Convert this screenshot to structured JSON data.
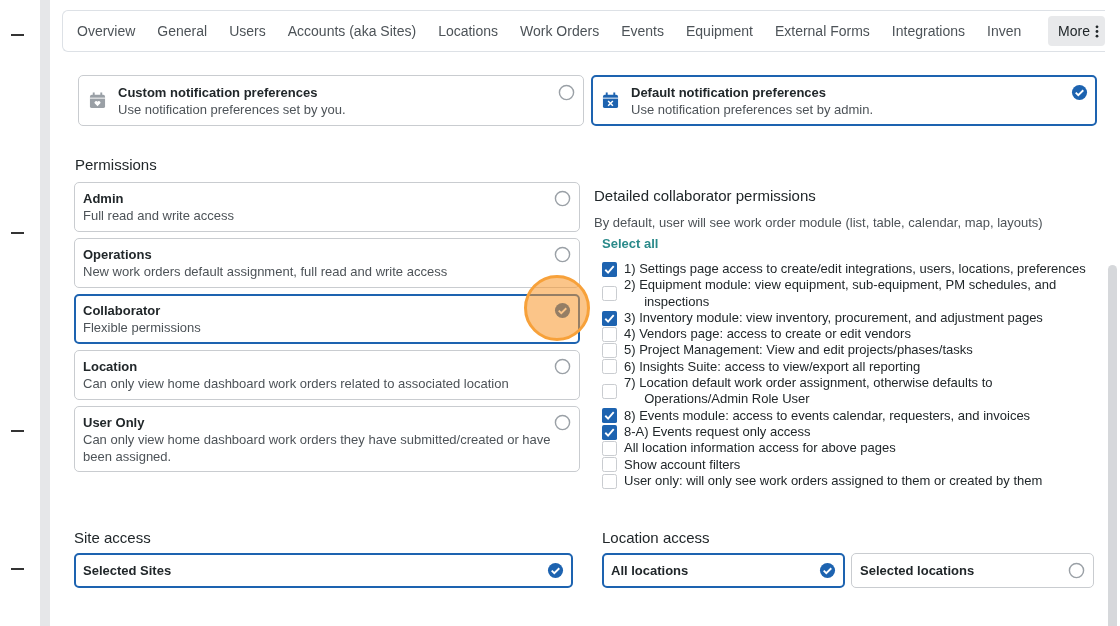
{
  "tabs": [
    {
      "label": "Overview",
      "selected": false
    },
    {
      "label": "General",
      "selected": false
    },
    {
      "label": "Users",
      "selected": false
    },
    {
      "label": "Accounts (aka Sites)",
      "selected": false
    },
    {
      "label": "Locations",
      "selected": false
    },
    {
      "label": "Work Orders",
      "selected": false
    },
    {
      "label": "Events",
      "selected": false
    },
    {
      "label": "Equipment",
      "selected": false
    },
    {
      "label": "External Forms",
      "selected": false
    },
    {
      "label": "Integrations",
      "selected": false
    },
    {
      "label": "Inven",
      "selected": false
    }
  ],
  "more_button": {
    "label": "More"
  },
  "notification_preferences": [
    {
      "kind": "custom",
      "title": "Custom notification preferences",
      "description": "Use notification preferences set by you.",
      "selected": false
    },
    {
      "kind": "default",
      "title": "Default notification preferences",
      "description": "Use notification preferences set by admin.",
      "selected": true
    }
  ],
  "permissions": {
    "heading": "Permissions",
    "roles": [
      {
        "title": "Admin",
        "description": "Full read and write access",
        "selected": false
      },
      {
        "title": "Operations",
        "description": "New work orders default assignment, full read and write access",
        "selected": false
      },
      {
        "title": "Collaborator",
        "description": "Flexible permissions",
        "selected": true
      },
      {
        "title": "Location",
        "description": "Can only view home dashboard work orders related to associated location",
        "selected": false
      },
      {
        "title": "User Only",
        "description": "Can only view home dashboard work orders they have submitted/created or have been assigned.",
        "selected": false
      }
    ]
  },
  "detailed_permissions": {
    "heading": "Detailed collaborator permissions",
    "note": "By default, user will see work order module (list, table, calendar, map, layouts)",
    "select_all": "Select all",
    "items": [
      {
        "label": "1) Settings page access to create/edit integrations, users, locations, preferences",
        "checked": true
      },
      {
        "label": "2) Equipment module: view equipment, sub-equipment, PM schedules, and inspections",
        "checked": false
      },
      {
        "label": "3) Inventory module: view inventory, procurement, and adjustment pages",
        "checked": true
      },
      {
        "label": "4) Vendors page: access to create or edit vendors",
        "checked": false
      },
      {
        "label": "5) Project Management: View and edit projects/phases/tasks",
        "checked": false
      },
      {
        "label": "6) Insights Suite: access to view/export all reporting",
        "checked": false
      },
      {
        "label": "7) Location default work order assignment, otherwise defaults to Operations/Admin Role User",
        "checked": false
      },
      {
        "label": "8) Events module: access to events calendar, requesters, and invoices",
        "checked": true
      },
      {
        "label": "8-A) Events request only access",
        "checked": true
      },
      {
        "label": "All location information access for above pages",
        "checked": false
      },
      {
        "label": "Show account filters",
        "checked": false
      },
      {
        "label": "User only: will only see work orders assigned to them or created by them",
        "checked": false
      }
    ]
  },
  "site_access": {
    "heading": "Site access",
    "options": [
      {
        "label": "Selected Sites",
        "selected": true
      }
    ]
  },
  "location_access": {
    "heading": "Location access",
    "options": [
      {
        "label": "All locations",
        "selected": true
      },
      {
        "label": "Selected locations",
        "selected": false
      }
    ]
  }
}
